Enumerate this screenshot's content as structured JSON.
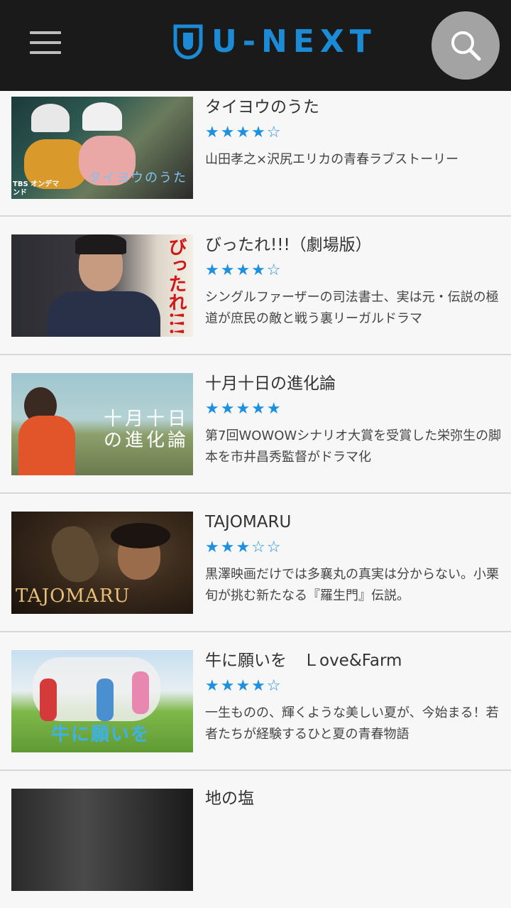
{
  "header": {
    "logo_text": "U-NEXT",
    "brand_color": "#1c8bd6",
    "menu_icon": "hamburger-icon",
    "search_icon": "search-icon"
  },
  "items": [
    {
      "title": "タイヨウのうた",
      "stars": "★★★★☆",
      "rating": 4,
      "description": "山田孝之×沢尻エリカの青春ラブストーリー",
      "thumb_caption": "タイヨウのうた",
      "thumb_badge": "TBS オンデマンド"
    },
    {
      "title": "びったれ!!!（劇場版）",
      "stars": "★★★★☆",
      "rating": 4,
      "description": "シングルファーザーの司法書士、実は元・伝説の極道が庶民の敵と戦う裏リーガルドラマ",
      "thumb_caption": "びったれ!!!"
    },
    {
      "title": "十月十日の進化論",
      "stars": "★★★★★",
      "rating": 5,
      "description": "第7回WOWOWシナリオ大賞を受賞した栄弥生の脚本を市井昌秀監督がドラマ化",
      "thumb_caption_1": "十月十日",
      "thumb_caption_2": "の進化論"
    },
    {
      "title": "TAJOMARU",
      "stars": "★★★☆☆",
      "rating": 3,
      "description": "黒澤映画だけでは多襄丸の真実は分からない。小栗旬が挑む新たなる『羅生門』伝説。",
      "thumb_caption": "TAJOMARU"
    },
    {
      "title": "牛に願いを　Ｌove&Farm",
      "stars": "★★★★☆",
      "rating": 4,
      "description": "一生ものの、輝くような美しい夏が、今始まる！若者たちが経験するひと夏の青春物語",
      "thumb_caption": "牛に願いを"
    },
    {
      "title": "地の塩"
    }
  ]
}
